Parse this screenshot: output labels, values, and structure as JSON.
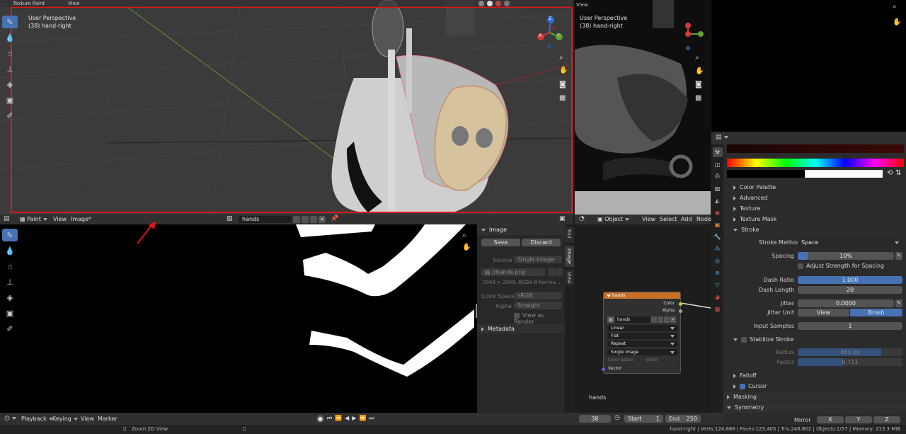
{
  "top_header": {
    "mode": "Texture Paint",
    "view": "View",
    "right_view": "View"
  },
  "viewport_main": {
    "overlay_title": "User Perspective",
    "overlay_object": "(38) hand-right",
    "gizmo": {
      "z": "Z",
      "x": "X",
      "y": "Y"
    }
  },
  "viewport_right": {
    "overlay_title": "User Perspective",
    "overlay_object": "(38) hand-right"
  },
  "image_editor_header": {
    "mode": "Paint",
    "view": "View",
    "image": "Image*",
    "image_name": "hands"
  },
  "image_sidebar": {
    "tabs": [
      "Tool",
      "Image",
      "View"
    ],
    "section_image": "Image",
    "save": "Save",
    "discard": "Discard",
    "source_label": "Source",
    "source_value": "Single Image",
    "filepath": "//hands.png",
    "info": "2048 × 2048,  RGBA 8 бит/ка...",
    "color_space_label": "Color Space",
    "color_space_value": "sRGB",
    "alpha_label": "Alpha",
    "alpha_value": "Straight",
    "view_as_render": "View as Render",
    "section_metadata": "Metadata"
  },
  "node_header": {
    "mode": "Object",
    "view": "View",
    "select": "Select",
    "add": "Add",
    "node": "Node"
  },
  "image_node": {
    "title": "hands",
    "out_color": "Color",
    "out_alpha": "Alpha",
    "image_name": "hands",
    "interpolation": "Linear",
    "projection": "Flat",
    "extension": "Repeat",
    "source": "Single Image",
    "color_space_label": "Color Space",
    "color_space_value": "sRGB",
    "in_vector": "Vector",
    "footer_label": "hands"
  },
  "properties": {
    "color_palette": "Color Palette",
    "advanced": "Advanced",
    "texture": "Texture",
    "texture_mask": "Texture Mask",
    "stroke": "Stroke",
    "stroke_method_label": "Stroke Method",
    "stroke_method_value": "Space",
    "spacing_label": "Spacing",
    "spacing_value": "10%",
    "spacing_fraction": 0.1,
    "adjust_strength": "Adjust Strength for Spacing",
    "dash_ratio_label": "Dash Ratio",
    "dash_ratio_value": "1.000",
    "dash_length_label": "Dash Length",
    "dash_length_value": "20",
    "jitter_label": "Jitter",
    "jitter_value": "0.0000",
    "jitter_unit_label": "Jitter Unit",
    "jitter_unit_view": "View",
    "jitter_unit_brush": "Brush",
    "input_samples_label": "Input Samples",
    "input_samples_value": "1",
    "stabilize_stroke": "Stabilize Stroke",
    "radius_label": "Radius",
    "radius_value": "163 px",
    "radius_fraction": 0.8,
    "factor_label": "Factor",
    "factor_value": "0.711",
    "factor_fraction": 0.43,
    "falloff": "Falloff",
    "cursor": "Cursor",
    "masking": "Masking",
    "symmetry": "Symmetry",
    "mirror_label": "Mirror",
    "mirror_x": "X",
    "mirror_y": "Y",
    "mirror_z": "Z"
  },
  "timeline": {
    "playback": "Playback",
    "keying": "Keying",
    "view": "View",
    "marker": "Marker",
    "current_frame": "38",
    "start_label": "Start",
    "start_value": "1",
    "end_label": "End",
    "end_value": "250"
  },
  "status_bar": {
    "hint": "Zoom 2D View",
    "stats": "hand-right | Verts:124,666 | Faces:123,405 | Tris:246,802 | Objects:1/57 | Memory: 213.3 MiB"
  },
  "colors": {
    "accent": "#4772b3",
    "highlight_box": "#e0161b",
    "node_header": "#c76f27"
  }
}
